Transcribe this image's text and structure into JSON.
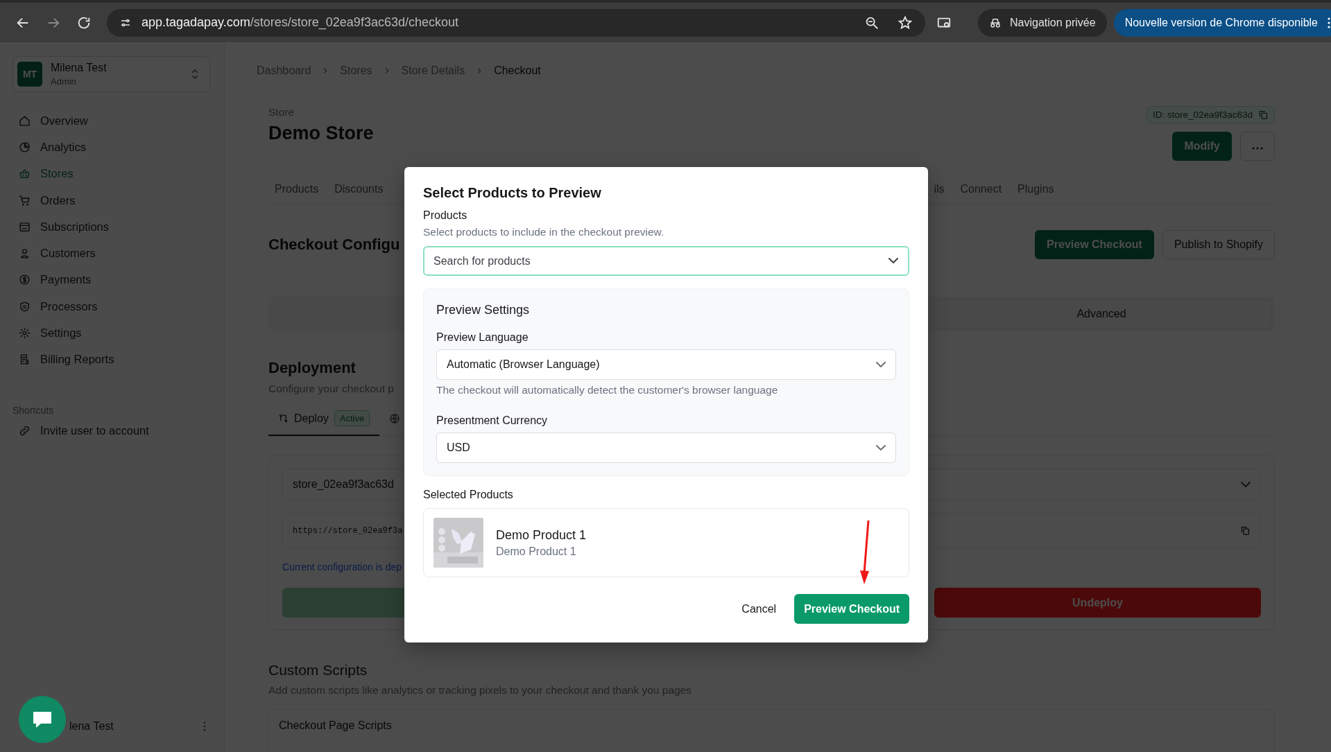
{
  "browser": {
    "url_host": "app.tagadapay.com",
    "url_path": "/stores/store_02ea9f3ac63d/checkout",
    "private_label": "Navigation privée",
    "update_label": "Nouvelle version de Chrome disponible"
  },
  "sidebar": {
    "account": {
      "initials": "MT",
      "name": "Milena Test",
      "role": "Admin"
    },
    "items": [
      {
        "label": "Overview",
        "selected": false
      },
      {
        "label": "Analytics",
        "selected": false
      },
      {
        "label": "Stores",
        "selected": true
      },
      {
        "label": "Orders",
        "selected": false
      },
      {
        "label": "Subscriptions",
        "selected": false
      },
      {
        "label": "Customers",
        "selected": false
      },
      {
        "label": "Payments",
        "selected": false
      },
      {
        "label": "Processors",
        "selected": false
      },
      {
        "label": "Settings",
        "selected": false
      },
      {
        "label": "Billing Reports",
        "selected": false
      }
    ],
    "shortcuts_title": "Shortcuts",
    "shortcuts": [
      {
        "label": "Invite user to account"
      }
    ],
    "footer_name": "lena Test"
  },
  "breadcrumb": [
    {
      "label": "Dashboard",
      "current": false
    },
    {
      "label": "Stores",
      "current": false
    },
    {
      "label": "Store Details",
      "current": false
    },
    {
      "label": "Checkout",
      "current": true
    }
  ],
  "store": {
    "label": "Store",
    "name": "Demo Store",
    "id": "ID: store_02ea9f3ac63d",
    "modify_button": "Modify"
  },
  "tabs_left": [
    "Products",
    "Discounts"
  ],
  "tabs_right": [
    "ils",
    "Connect",
    "Plugins"
  ],
  "checkout_config": {
    "title": "Checkout Configu",
    "preview_button": "Preview Checkout",
    "publish_button": "Publish to Shopify",
    "section_tab": "Advanced"
  },
  "deployment": {
    "title": "Deployment",
    "description": "Configure your checkout p",
    "tabs": [
      {
        "label": "Deploy",
        "badge": "Active",
        "selected": true
      }
    ],
    "store_select": "store_02ea9f3ac63d",
    "url": "https://store_02ea9f3a",
    "note": "Current configuration is dep",
    "undeploy_button": "Undeploy"
  },
  "custom_scripts": {
    "title": "Custom Scripts",
    "description": "Add custom scripts like analytics or tracking pixels to your checkout and thank you pages",
    "card_title": "Checkout Page Scripts"
  },
  "dialog": {
    "title": "Select Products to Preview",
    "products_label": "Products",
    "products_hint": "Select products to include in the checkout preview.",
    "search": {
      "placeholder": "Search for products"
    },
    "settings_title": "Preview Settings",
    "language_label": "Preview Language",
    "language_value": "Automatic (Browser Language)",
    "language_hint": "The checkout will automatically detect the customer's browser language",
    "currency_label": "Presentment Currency",
    "currency_value": "USD",
    "selected_title": "Selected Products",
    "products": [
      {
        "name": "Demo Product 1",
        "subtitle": "Demo Product 1"
      }
    ],
    "cancel_button": "Cancel",
    "confirm_button": "Preview Checkout"
  }
}
